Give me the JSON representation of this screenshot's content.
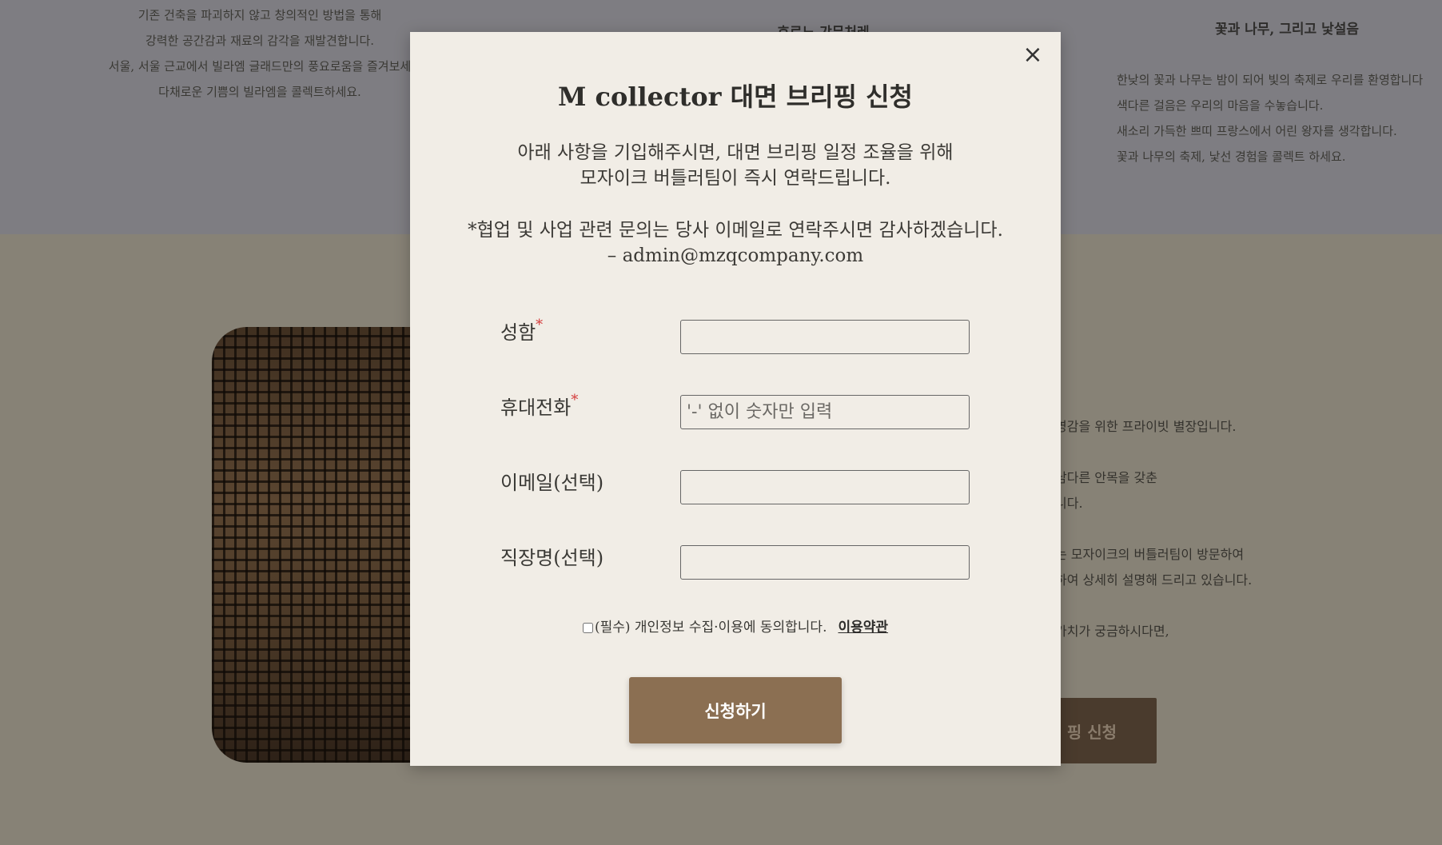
{
  "background": {
    "col1_lines": [
      "기존 건축을 파괴하지 않고 창의적인 방법을 통해",
      "강력한 공간감과 재료의 감각을 재발견합니다.",
      "서울, 서울 근교에서 빌라엠 글래드만의 풍요로움을 즐겨보세",
      "다채로운 기쁨의 빌라엠을 콜렉트하세요."
    ],
    "col2_title": "호로느 갸무처레",
    "col3_title": "꽃과 나무, 그리고 낯설음",
    "col3_lines": [
      "한낮의 꽃과 나무는 밤이 되어 빛의 축제로 우리를 환영합니다",
      "색다른 걸음은 우리의 마음을 수놓습니다.",
      "새소리 가득한 쁘띠 프랑스에서 어린 왕자를 생각합니다.",
      "꽃과 나무의 축제, 낯선 경험을 콜렉트 하세요."
    ],
    "right_text": [
      "영감을 위한 프라이빗 별장입니다.",
      "남다른 안목을 갖춘",
      "니다.",
      "는 모자이크의 버틀러팀이 방문하여",
      "하여 상세히 설명해 드리고 있습니다.",
      "가치가 궁금하시다면,"
    ],
    "button_label": "핑 신청"
  },
  "modal": {
    "title": "M collector 대면 브리핑 신청",
    "desc_line1": "아래 사항을 기입해주시면, 대면 브리핑 일정 조율을 위해",
    "desc_line2": "모자이크 버틀러팀이 즉시 연락드립니다.",
    "note_line1": "*협업 및 사업 관련 문의는 당사 이메일로 연락주시면 감사하겠습니다.",
    "note_line2": "– admin@mzqcompany.com",
    "close_icon": "×",
    "fields": {
      "name_label": "성함",
      "phone_label": "휴대전화",
      "phone_placeholder": "'-' 없이 숫자만 입력",
      "email_label": "이메일(선택)",
      "company_label": "직장명(선택)",
      "required_mark": "*"
    },
    "consent_text": "(필수) 개인정보 수집·이용에 동의합니다.",
    "terms_link": "이용약관",
    "submit_label": "신청하기"
  },
  "colors": {
    "submit_bg": "#8b6f52",
    "modal_bg": "#f1ede6",
    "required": "#d43a3a"
  }
}
